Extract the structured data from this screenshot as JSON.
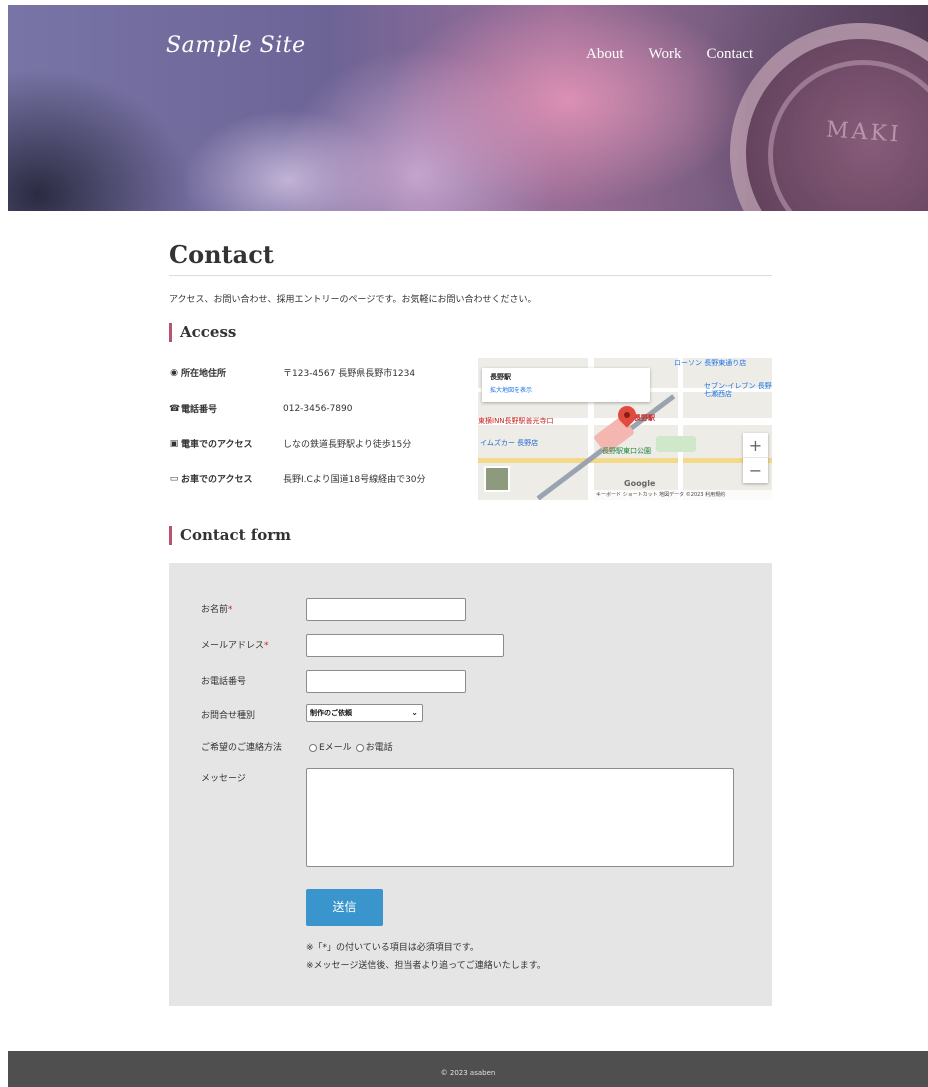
{
  "header": {
    "logo": "Sample Site",
    "nav": [
      "About",
      "Work",
      "Contact"
    ],
    "cup_text": "MAKI"
  },
  "page": {
    "title": "Contact",
    "intro": "アクセス、お問い合わせ、採用エントリーのページです。お気軽にお問い合わせください。"
  },
  "access": {
    "heading": "Access",
    "rows": [
      {
        "icon": "map-pin-icon",
        "label": "所在地住所",
        "value": "〒123-4567 長野県長野市1234"
      },
      {
        "icon": "phone-icon",
        "label": "電話番号",
        "value": "012-3456-7890"
      },
      {
        "icon": "train-icon",
        "label": "電車でのアクセス",
        "value": "しなの鉄道長野駅より徒歩15分"
      },
      {
        "icon": "car-icon",
        "label": "お車でのアクセス",
        "value": "長野I.Cより国道18号線経由で30分"
      }
    ],
    "map": {
      "place_name": "長野駅",
      "view_larger": "拡大地図を表示",
      "labels": [
        "長野駅",
        "長野駅東口公園",
        "セブン-イレブン 長野七瀬西店",
        "ローソン 長野東通り店",
        "東横INN長野駅善光寺口",
        "イムズカー 長野店"
      ],
      "zoom_in": "+",
      "zoom_out": "−",
      "google": "Google",
      "attribution": "キーボード ショートカット  地図データ ©2023  利用規約"
    }
  },
  "contact_form": {
    "heading": "Contact form",
    "required_mark": "*",
    "fields": {
      "name": "お名前",
      "email": "メールアドレス",
      "phone": "お電話番号",
      "inquiry_type": "お問合せ種別",
      "contact_method": "ご希望のご連絡方法",
      "message": "メッセージ"
    },
    "inquiry_selected": "制作のご依頼",
    "chevron": "⌄",
    "radio_options": [
      "Eメール",
      "お電話"
    ],
    "submit_label": "送信",
    "notes": [
      "※「*」の付いている項目は必須項目です。",
      "※メッセージ送信後、担当者より追ってご連絡いたします。"
    ]
  },
  "footer": {
    "copyright": "© 2023 asaben"
  }
}
